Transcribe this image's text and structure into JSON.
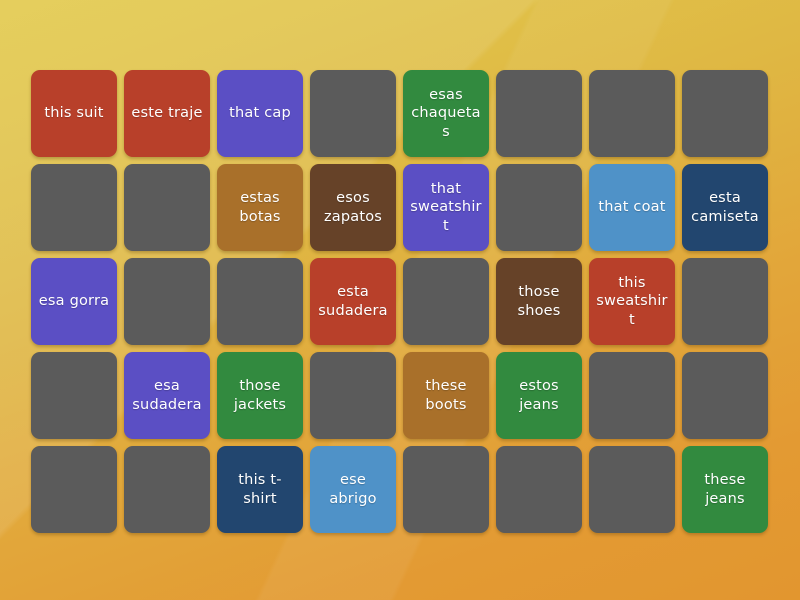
{
  "board": {
    "name": "matching-pairs-grid",
    "columns": 8,
    "rows": 5,
    "background_top_color": "#e2c94b",
    "background_bottom_color": "#e2962f"
  },
  "palette": {
    "gray": "#5b5b5b",
    "red": "#b8402a",
    "purple": "#5b4fc4",
    "green": "#328a3f",
    "tan": "#a9702a",
    "brown": "#664228",
    "lightblue": "#4f92c8",
    "navy": "#22466f",
    "text": "#ffffff"
  },
  "tiles": [
    {
      "label": "this suit",
      "color": "red",
      "state": "revealed"
    },
    {
      "label": "este traje",
      "color": "red",
      "state": "revealed"
    },
    {
      "label": "that cap",
      "color": "purple",
      "state": "revealed"
    },
    {
      "label": "",
      "color": "gray",
      "state": "hidden"
    },
    {
      "label": "esas chaquetas",
      "color": "green",
      "state": "revealed"
    },
    {
      "label": "",
      "color": "gray",
      "state": "hidden"
    },
    {
      "label": "",
      "color": "gray",
      "state": "hidden"
    },
    {
      "label": "",
      "color": "gray",
      "state": "hidden"
    },
    {
      "label": "",
      "color": "gray",
      "state": "hidden"
    },
    {
      "label": "",
      "color": "gray",
      "state": "hidden"
    },
    {
      "label": "estas botas",
      "color": "tan",
      "state": "revealed"
    },
    {
      "label": "esos zapatos",
      "color": "brown",
      "state": "revealed"
    },
    {
      "label": "that sweatshirt",
      "color": "purple",
      "state": "revealed"
    },
    {
      "label": "",
      "color": "gray",
      "state": "hidden"
    },
    {
      "label": "that coat",
      "color": "lightblue",
      "state": "revealed"
    },
    {
      "label": "esta camiseta",
      "color": "navy",
      "state": "revealed"
    },
    {
      "label": "esa gorra",
      "color": "purple",
      "state": "revealed"
    },
    {
      "label": "",
      "color": "gray",
      "state": "hidden"
    },
    {
      "label": "",
      "color": "gray",
      "state": "hidden"
    },
    {
      "label": "esta sudadera",
      "color": "red",
      "state": "revealed"
    },
    {
      "label": "",
      "color": "gray",
      "state": "hidden"
    },
    {
      "label": "those shoes",
      "color": "brown",
      "state": "revealed"
    },
    {
      "label": "this sweatshirt",
      "color": "red",
      "state": "revealed"
    },
    {
      "label": "",
      "color": "gray",
      "state": "hidden"
    },
    {
      "label": "",
      "color": "gray",
      "state": "hidden"
    },
    {
      "label": "esa sudadera",
      "color": "purple",
      "state": "revealed"
    },
    {
      "label": "those jackets",
      "color": "green",
      "state": "revealed"
    },
    {
      "label": "",
      "color": "gray",
      "state": "hidden"
    },
    {
      "label": "these boots",
      "color": "tan",
      "state": "revealed"
    },
    {
      "label": "estos jeans",
      "color": "green",
      "state": "revealed"
    },
    {
      "label": "",
      "color": "gray",
      "state": "hidden"
    },
    {
      "label": "",
      "color": "gray",
      "state": "hidden"
    },
    {
      "label": "",
      "color": "gray",
      "state": "hidden"
    },
    {
      "label": "",
      "color": "gray",
      "state": "hidden"
    },
    {
      "label": "this t-shirt",
      "color": "navy",
      "state": "revealed"
    },
    {
      "label": "ese abrigo",
      "color": "lightblue",
      "state": "revealed"
    },
    {
      "label": "",
      "color": "gray",
      "state": "hidden"
    },
    {
      "label": "",
      "color": "gray",
      "state": "hidden"
    },
    {
      "label": "",
      "color": "gray",
      "state": "hidden"
    },
    {
      "label": "these jeans",
      "color": "green",
      "state": "revealed"
    }
  ]
}
